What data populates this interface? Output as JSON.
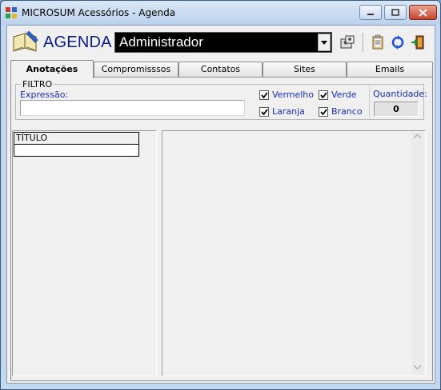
{
  "window": {
    "title": "MICROSUM Acessórios - Agenda"
  },
  "header": {
    "app_label": "AGENDA",
    "user": "Administrador"
  },
  "tabs": [
    {
      "label": "Anotações",
      "active": true
    },
    {
      "label": "Compromisssos",
      "active": false
    },
    {
      "label": "Contatos",
      "active": false
    },
    {
      "label": "Sites",
      "active": false
    },
    {
      "label": "Emails",
      "active": false
    }
  ],
  "filter": {
    "legend": "FILTRO",
    "expression_label": "Expressão:",
    "expression_value": "",
    "checkboxes": [
      {
        "label": "Vermelho",
        "checked": true
      },
      {
        "label": "Verde",
        "checked": true
      },
      {
        "label": "Laranja",
        "checked": true
      },
      {
        "label": "Branco",
        "checked": true
      }
    ],
    "quantity_label": "Quantidade:",
    "quantity_value": "0"
  },
  "list": {
    "column_header": "TÍTULO"
  },
  "colors": {
    "accent_text": "#1a2bb0",
    "header_text": "#0b1a8c",
    "combo_bg": "#000000",
    "close_button": "#c7422b"
  },
  "icons": [
    "app-icon",
    "book-pen-icon",
    "dropdown-arrow-icon",
    "users-config-icon",
    "clipboard-icon",
    "refresh-icon",
    "exit-door-icon",
    "minimize-icon",
    "maximize-icon",
    "close-icon",
    "checkmark-icon",
    "scroll-up-icon",
    "scroll-down-icon"
  ]
}
